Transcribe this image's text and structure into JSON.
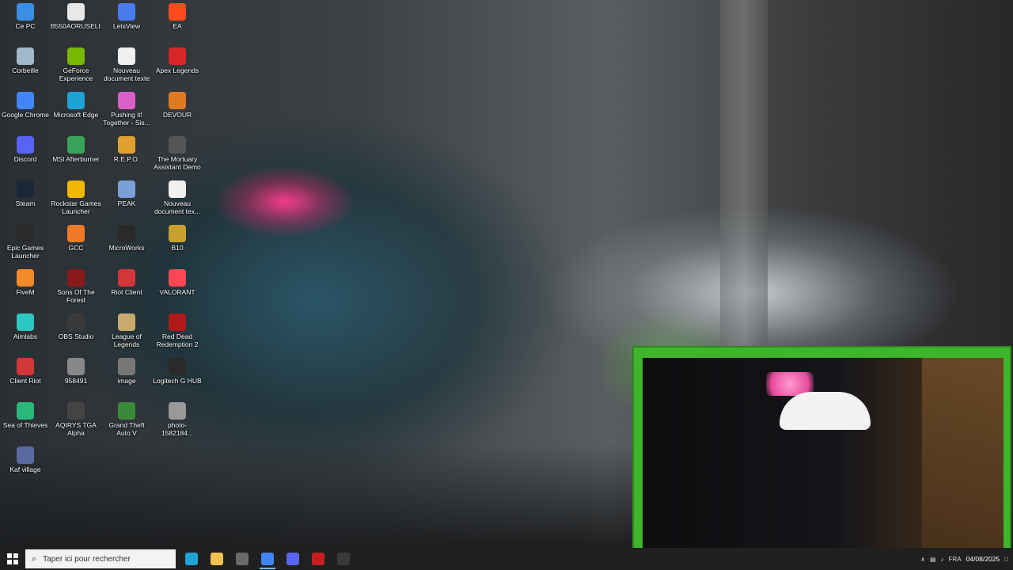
{
  "desktop": {
    "icons": [
      {
        "label": "Ce PC",
        "icon": "computer-icon",
        "color": "#3a8ee6"
      },
      {
        "label": "B550AORUSELI...",
        "icon": "document-icon",
        "color": "#e8e8e8"
      },
      {
        "label": "LetsView",
        "icon": "letsview-icon",
        "color": "#4a7cf0"
      },
      {
        "label": "EA",
        "icon": "ea-icon",
        "color": "#ff4a1c"
      },
      {
        "label": "Corbeille",
        "icon": "recycle-bin-icon",
        "color": "#9fb8cc"
      },
      {
        "label": "GeForce Experience",
        "icon": "geforce-icon",
        "color": "#76b900"
      },
      {
        "label": "Nouveau document texte",
        "icon": "text-file-icon",
        "color": "#f0f0f0"
      },
      {
        "label": "Apex Legends",
        "icon": "apex-icon",
        "color": "#d8262b"
      },
      {
        "label": "Google Chrome",
        "icon": "chrome-icon",
        "color": "#4285f4"
      },
      {
        "label": "Microsoft Edge",
        "icon": "edge-icon",
        "color": "#1fa3d6"
      },
      {
        "label": "Pushing it! Together - Sis...",
        "icon": "game-icon",
        "color": "#d860c8"
      },
      {
        "label": "DEVOUR",
        "icon": "devour-icon",
        "color": "#e07a20"
      },
      {
        "label": "Discord",
        "icon": "discord-icon",
        "color": "#5865f2"
      },
      {
        "label": "MSI Afterburner",
        "icon": "afterburner-icon",
        "color": "#3aa35a"
      },
      {
        "label": "R.E.P.O.",
        "icon": "repo-icon",
        "color": "#e0a030"
      },
      {
        "label": "The Mortuary Assistant Demo",
        "icon": "mortuary-icon",
        "color": "#555555"
      },
      {
        "label": "Steam",
        "icon": "steam-icon",
        "color": "#1b2838"
      },
      {
        "label": "Rockstar Games Launcher",
        "icon": "rockstar-icon",
        "color": "#f2b705"
      },
      {
        "label": "PEAK",
        "icon": "peak-icon",
        "color": "#7aa0d8"
      },
      {
        "label": "Nouveau document tex...",
        "icon": "text-file-icon",
        "color": "#f0f0f0"
      },
      {
        "label": "Epic Games Launcher",
        "icon": "epic-icon",
        "color": "#2a2a2a"
      },
      {
        "label": "GCC",
        "icon": "gcc-icon",
        "color": "#f07a2a"
      },
      {
        "label": "MicroWorks",
        "icon": "microworks-icon",
        "color": "#2a2a2a"
      },
      {
        "label": "B10",
        "icon": "b10-icon",
        "color": "#c8a030"
      },
      {
        "label": "FiveM",
        "icon": "fivem-icon",
        "color": "#f08a2a"
      },
      {
        "label": "Sons Of The Forest",
        "icon": "sotf-icon",
        "color": "#8a1a1a"
      },
      {
        "label": "Riot Client",
        "icon": "riot-icon",
        "color": "#d13639"
      },
      {
        "label": "VALORANT",
        "icon": "valorant-icon",
        "color": "#ff4655"
      },
      {
        "label": "Aimlabs",
        "icon": "aimlabs-icon",
        "color": "#2ac8c0"
      },
      {
        "label": "OBS Studio",
        "icon": "obs-icon",
        "color": "#3a3a3a"
      },
      {
        "label": "League of Legends",
        "icon": "lol-icon",
        "color": "#c8aa6e"
      },
      {
        "label": "Red Dead Redemption 2",
        "icon": "rdr2-icon",
        "color": "#b01a1a"
      },
      {
        "label": "Client Riot",
        "icon": "riot-icon",
        "color": "#d13639"
      },
      {
        "label": "958491",
        "icon": "image-file-icon",
        "color": "#888888"
      },
      {
        "label": "image",
        "icon": "image-file-icon",
        "color": "#777777"
      },
      {
        "label": "Logitech G HUB",
        "icon": "ghub-icon",
        "color": "#2a2a2a"
      },
      {
        "label": "Sea of Thieves",
        "icon": "sot-icon",
        "color": "#2ab87a"
      },
      {
        "label": "AQIRYS TGA Alpha",
        "icon": "aqirys-icon",
        "color": "#444444"
      },
      {
        "label": "Grand Theft Auto V",
        "icon": "gta-icon",
        "color": "#3a8a3a"
      },
      {
        "label": "photo-1582184...",
        "icon": "image-file-icon",
        "color": "#999999"
      },
      {
        "label": "Kaf village",
        "icon": "kaf-icon",
        "color": "#5a6aa0"
      }
    ]
  },
  "taskbar": {
    "search_placeholder": "Taper ici pour rechercher",
    "apps": [
      {
        "name": "edge",
        "icon": "edge-icon",
        "color": "#1fa3d6",
        "active": false
      },
      {
        "name": "explorer",
        "icon": "folder-icon",
        "color": "#f2c14e",
        "active": false
      },
      {
        "name": "store",
        "icon": "store-icon",
        "color": "#6a6a6a",
        "active": false
      },
      {
        "name": "chrome",
        "icon": "chrome-icon",
        "color": "#4285f4",
        "active": true
      },
      {
        "name": "discord",
        "icon": "discord-icon",
        "color": "#5865f2",
        "active": false
      },
      {
        "name": "voicemeeter",
        "icon": "voicemeeter-icon",
        "color": "#c81e1e",
        "active": false
      },
      {
        "name": "obs",
        "icon": "obs-icon",
        "color": "#3a3a3a",
        "active": false
      }
    ],
    "tray": {
      "date": "04/08/2025",
      "lang": "FRA"
    }
  }
}
